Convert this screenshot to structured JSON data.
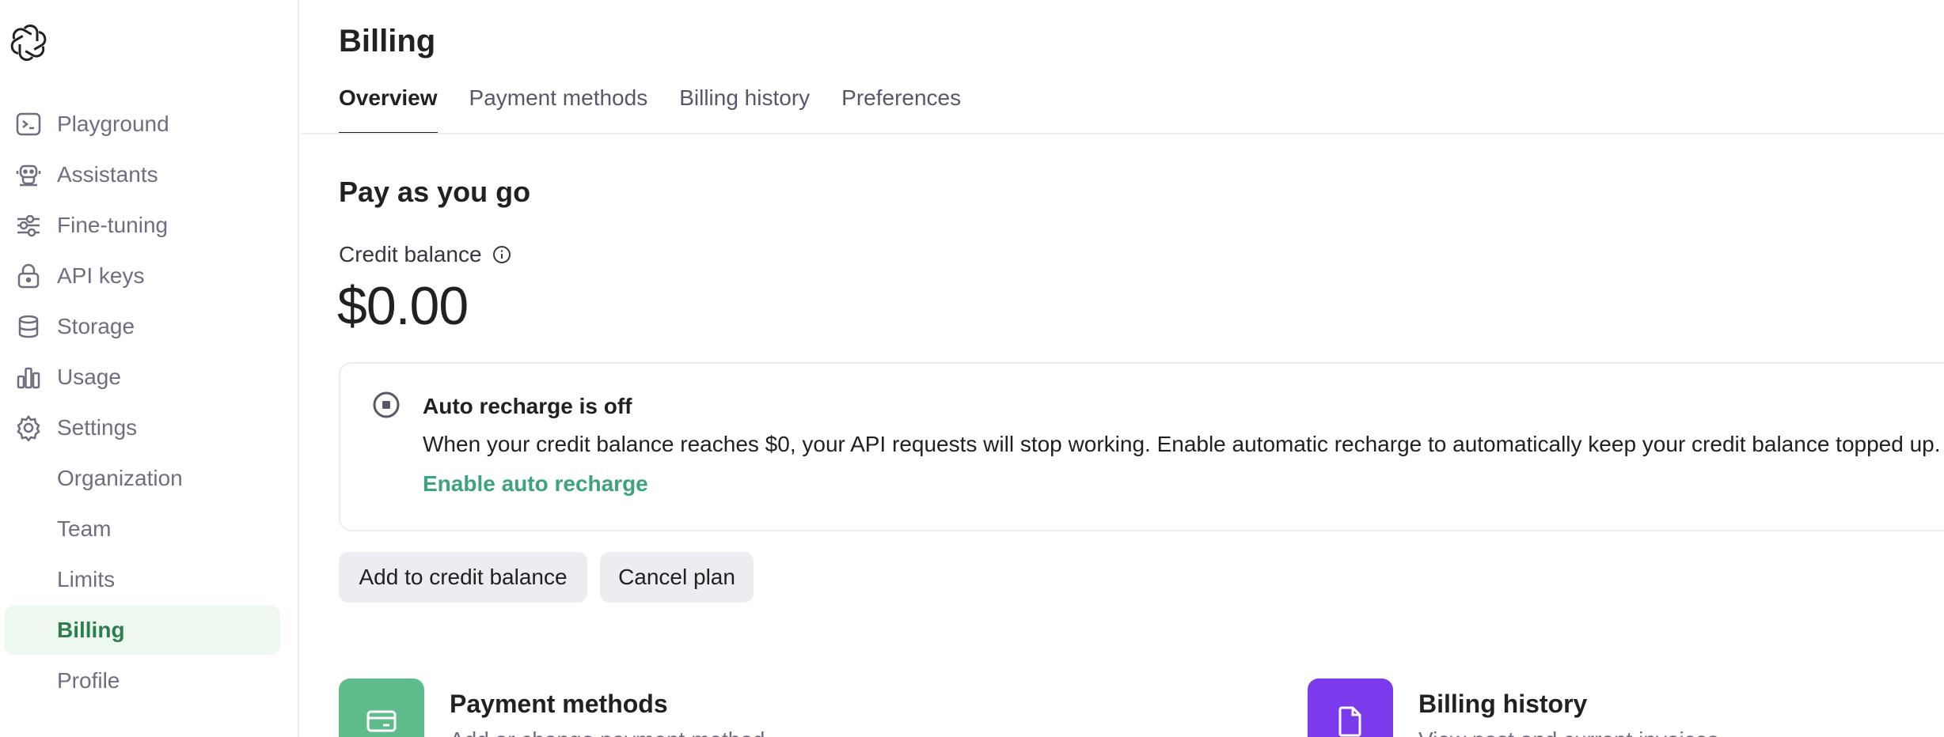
{
  "sidebar": {
    "logo": "openai-logo",
    "items": [
      {
        "label": "Playground",
        "icon": "terminal-icon"
      },
      {
        "label": "Assistants",
        "icon": "robot-icon"
      },
      {
        "label": "Fine-tuning",
        "icon": "sliders-icon"
      },
      {
        "label": "API keys",
        "icon": "lock-icon"
      },
      {
        "label": "Storage",
        "icon": "database-icon"
      },
      {
        "label": "Usage",
        "icon": "bar-chart-icon"
      },
      {
        "label": "Settings",
        "icon": "gear-icon"
      }
    ],
    "settings_items": [
      {
        "label": "Organization"
      },
      {
        "label": "Team"
      },
      {
        "label": "Limits"
      },
      {
        "label": "Billing",
        "active": true
      },
      {
        "label": "Profile"
      }
    ]
  },
  "header": {
    "title": "Billing",
    "tabs": [
      {
        "label": "Overview",
        "active": true
      },
      {
        "label": "Payment methods"
      },
      {
        "label": "Billing history"
      },
      {
        "label": "Preferences"
      }
    ]
  },
  "main": {
    "section_title": "Pay as you go",
    "credit_label": "Credit balance",
    "credit_value": "$0.00",
    "recharge": {
      "title": "Auto recharge is off",
      "description": "When your credit balance reaches $0, your API requests will stop working. Enable automatic recharge to automatically keep your credit balance topped up.",
      "link": "Enable auto recharge"
    },
    "buttons": {
      "add_credit": "Add to credit balance",
      "cancel_plan": "Cancel plan"
    },
    "features": [
      {
        "title": "Payment methods",
        "description": "Add or change payment method",
        "icon": "credit-card-icon",
        "color": "#5fba8c"
      },
      {
        "title": "Billing history",
        "description": "View past and current invoices",
        "icon": "document-icon",
        "color": "#7c3aed"
      }
    ]
  },
  "colors": {
    "accent_green": "#3ea27a",
    "active_bg": "#edf8ee",
    "active_text": "#2f7d4f"
  }
}
